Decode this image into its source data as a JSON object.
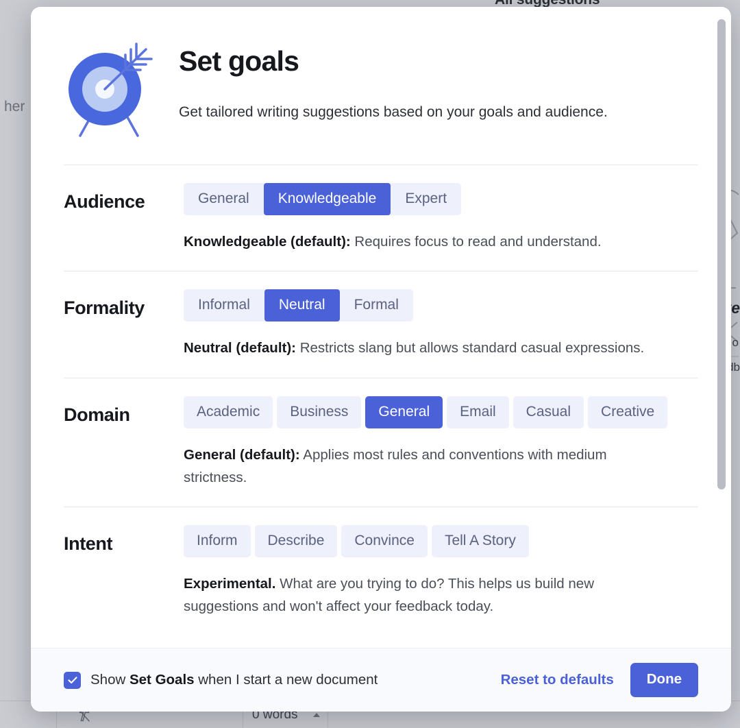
{
  "background": {
    "suggestions_title": "All suggestions",
    "side_text": "her",
    "right_fragment_1": "ve",
    "right_fragment_2": "o",
    "right_fragment_3": "db",
    "word_count": "0 words"
  },
  "modal": {
    "icon": "target-with-arrow-icon",
    "title": "Set goals",
    "subtitle": "Get tailored writing suggestions based on your goals and audience.",
    "sections": [
      {
        "key": "audience",
        "label": "Audience",
        "control": "segmented",
        "options": [
          "General",
          "Knowledgeable",
          "Expert"
        ],
        "selected": "Knowledgeable",
        "description_bold": "Knowledgeable (default):",
        "description_rest": " Requires focus to read and understand."
      },
      {
        "key": "formality",
        "label": "Formality",
        "control": "segmented",
        "options": [
          "Informal",
          "Neutral",
          "Formal"
        ],
        "selected": "Neutral",
        "description_bold": "Neutral (default):",
        "description_rest": " Restricts slang but allows standard casual expressions."
      },
      {
        "key": "domain",
        "label": "Domain",
        "control": "pills",
        "options": [
          "Academic",
          "Business",
          "General",
          "Email",
          "Casual",
          "Creative"
        ],
        "selected": "General",
        "description_bold": "General (default):",
        "description_rest": " Applies most rules and conventions with medium strictness."
      },
      {
        "key": "intent",
        "label": "Intent",
        "control": "pills",
        "options": [
          "Inform",
          "Describe",
          "Convince",
          "Tell A Story"
        ],
        "selected": null,
        "description_bold": "Experimental.",
        "description_rest": " What are you trying to do? This helps us build new suggestions and won't affect your feedback today."
      }
    ],
    "footer": {
      "checkbox_checked": true,
      "checkbox_label_pre": "Show ",
      "checkbox_label_bold": "Set Goals",
      "checkbox_label_post": " when I start a new document",
      "reset_label": "Reset to defaults",
      "done_label": "Done"
    }
  },
  "colors": {
    "accent": "#4a61d8",
    "pill_bg": "#eef0fb",
    "pill_text": "#5b6180",
    "footer_bg": "#f9fafd",
    "overlay": "#c9cbd1"
  }
}
